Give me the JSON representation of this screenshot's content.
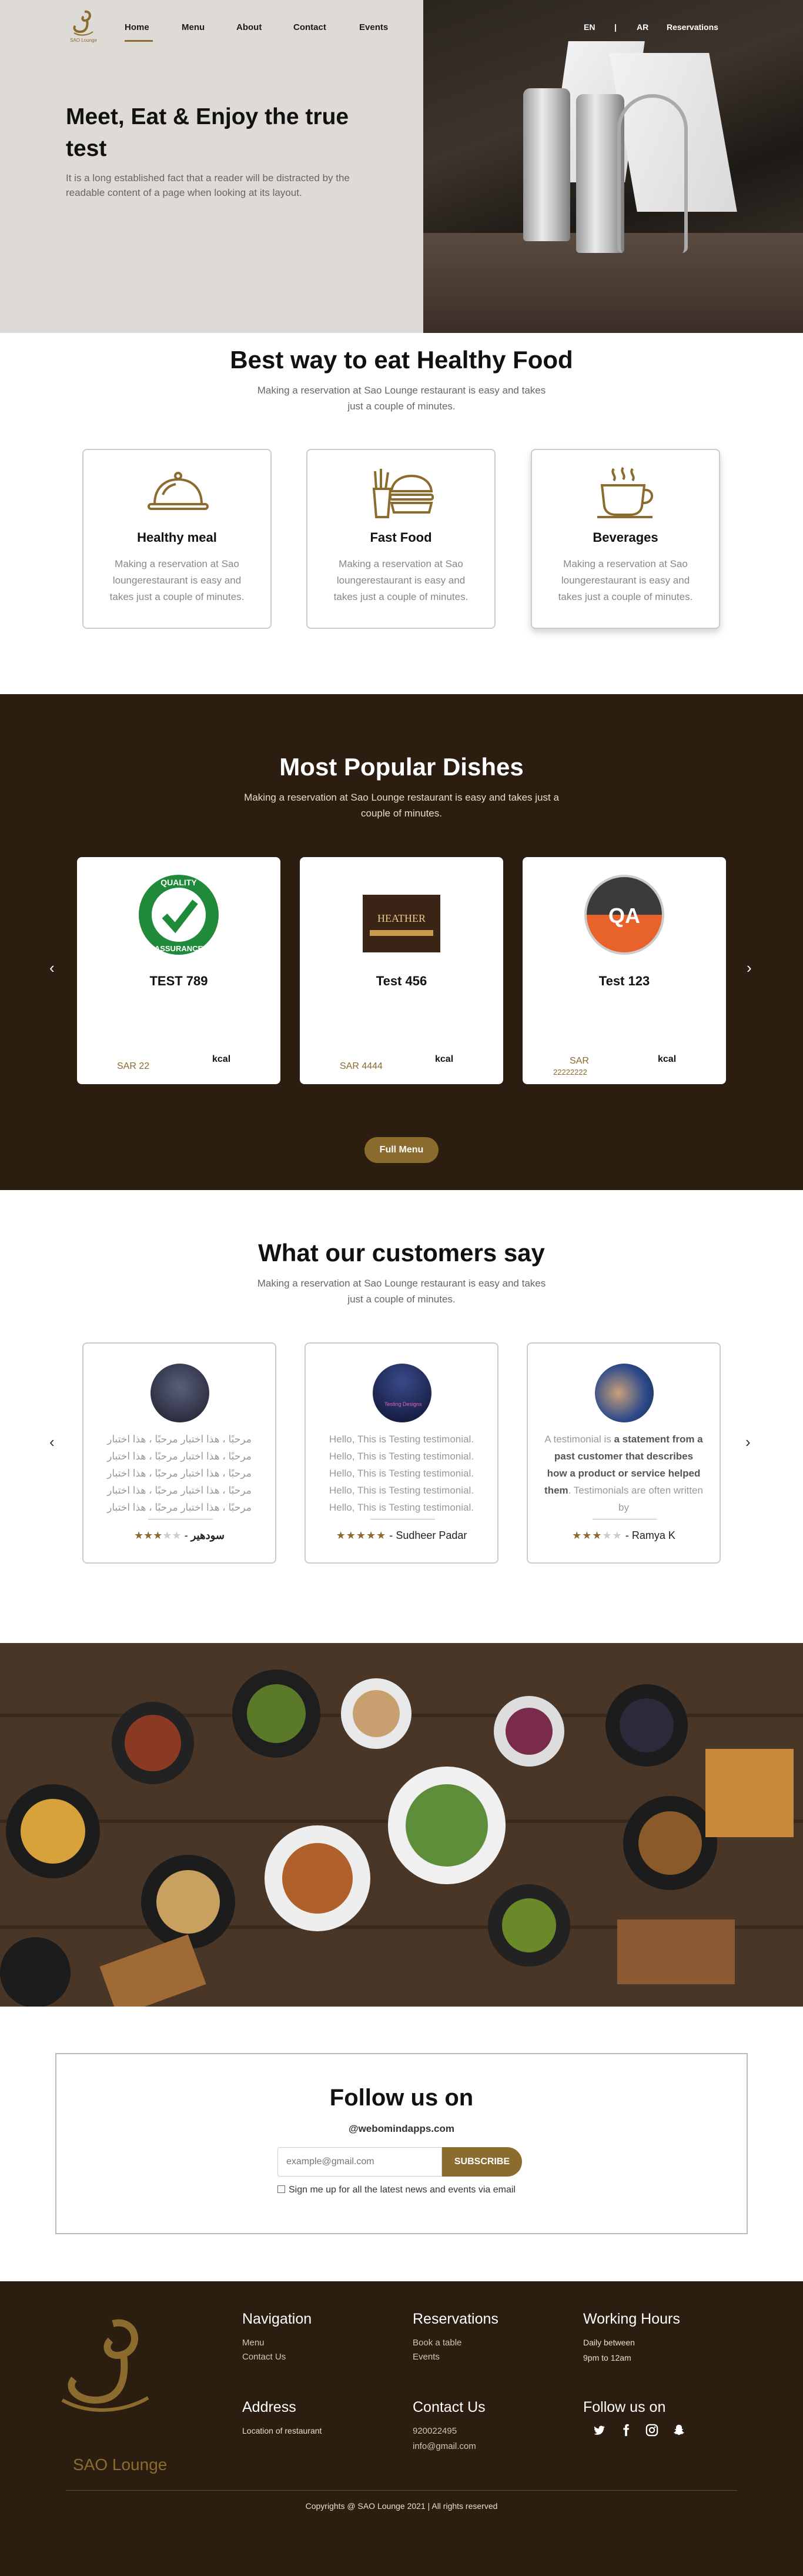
{
  "brand": {
    "name": "SAO Lounge",
    "accent": "#8b6b2e",
    "dark_bg": "#2b1d0f"
  },
  "nav": {
    "items": [
      {
        "label": "Home",
        "active": true
      },
      {
        "label": "Menu"
      },
      {
        "label": "About"
      },
      {
        "label": "Contact"
      },
      {
        "label": "Events"
      }
    ],
    "lang_en": "EN",
    "divider": "|",
    "lang_ar": "AR",
    "reservations": "Reservations"
  },
  "hero": {
    "title": "Meet, Eat & Enjoy the true test",
    "text": "It is a long established fact that a reader will be distracted by the readable content of a page when looking at its layout."
  },
  "features": {
    "title": "Best way to eat Healthy Food",
    "subtitle": "Making a reservation at Sao Lounge restaurant is easy and takes just a couple of minutes.",
    "cards": [
      {
        "icon": "cloche-icon",
        "title": "Healthy meal",
        "text": "Making a reservation at Sao loungerestaurant is easy and takes just a couple of minutes."
      },
      {
        "icon": "burger-fries-icon",
        "title": "Fast Food",
        "text": "Making a reservation at Sao loungerestaurant is easy and takes just a couple of minutes."
      },
      {
        "icon": "coffee-cup-icon",
        "title": "Beverages",
        "text": "Making a reservation at Sao loungerestaurant is easy and takes just a couple of minutes."
      }
    ]
  },
  "dishes": {
    "title": "Most Popular Dishes",
    "subtitle": "Making a reservation at Sao Lounge restaurant is easy and takes just a couple of minutes.",
    "items": [
      {
        "name": "TEST 789",
        "price": "SAR 22",
        "kcal": "kcal",
        "image": "quality-assurance-badge",
        "badge_top": "QUALITY",
        "badge_bottom": "ASSURANCE"
      },
      {
        "name": "Test 456",
        "price": "SAR 4444",
        "kcal": "kcal",
        "image": "dark-sign-image",
        "sign_text": "HEATHER"
      },
      {
        "name": "Test 123",
        "price": "SAR",
        "price_extra": "22222222",
        "kcal": "kcal",
        "image": "qa-circle-image",
        "qa_text": "QA"
      }
    ],
    "full_menu": "Full Menu",
    "prev": "‹",
    "next": "›"
  },
  "testimonials": {
    "title": "What our customers say",
    "subtitle": "Making a reservation at Sao Lounge restaurant is easy and takes just a couple of minutes.",
    "items": [
      {
        "text": "مرحبًا ، هذا اختبار مرحبًا ، هذا اختبار مرحبًا ، هذا اختبار مرحبًا ، هذا اختبار مرحبًا ، هذا اختبار مرحبًا ، هذا اختبار مرحبًا ، هذا اختبار مرحبًا ، هذا اختبار مرحبًا ، هذا اختبار مرحبًا ، هذا اختبار مرحبًا ، هذا اختبار مرحبًا ، هذا اختبار مرحبًا ، هذا اختبار",
        "rating": 3,
        "name": "سودهير",
        "dash": "-"
      },
      {
        "text": "Hello, This is Testing testimonial. Hello, This is Testing testimonial. Hello, This is Testing testimonial. Hello, This is Testing testimonial. Hello, This is Testing testimonial.",
        "rating": 5,
        "name": "Sudheer Padar",
        "dash": "-",
        "avatar_text": "Testing Designs"
      },
      {
        "text_pre": "A testimonial is ",
        "text_bold": "a statement from a past customer that describes how a product or service helped them",
        "text_post": ". Testimonials are often written by",
        "rating": 3,
        "name": "Ramya K",
        "dash": "-"
      }
    ],
    "prev": "‹",
    "next": "›"
  },
  "follow": {
    "title": "Follow us on",
    "site": "@webomindapps.com",
    "email_placeholder": "example@gmail.com",
    "subscribe": "SUBSCRIBE",
    "checkbox_label": "Sign me up for all the latest news and events via email"
  },
  "footer": {
    "logo_text": "SAO Lounge",
    "navigation": {
      "title": "Navigation",
      "links": [
        "Menu",
        "Contact Us"
      ]
    },
    "reservations": {
      "title": "Reservations",
      "links": [
        "Book a table",
        "Events"
      ]
    },
    "hours": {
      "title": "Working Hours",
      "line1": "Daily between",
      "line2": "9pm to 12am"
    },
    "address": {
      "title": "Address",
      "text": "Location of restaurant"
    },
    "contact": {
      "title": "Contact Us",
      "phone": "920022495",
      "email": "info@gmail.com"
    },
    "social": {
      "title": "Follow us on",
      "icons": [
        "twitter-icon",
        "facebook-icon",
        "instagram-icon",
        "snapchat-icon"
      ]
    },
    "copyright": "Copyrights @ SAO Lounge 2021 | All rights reserved"
  }
}
